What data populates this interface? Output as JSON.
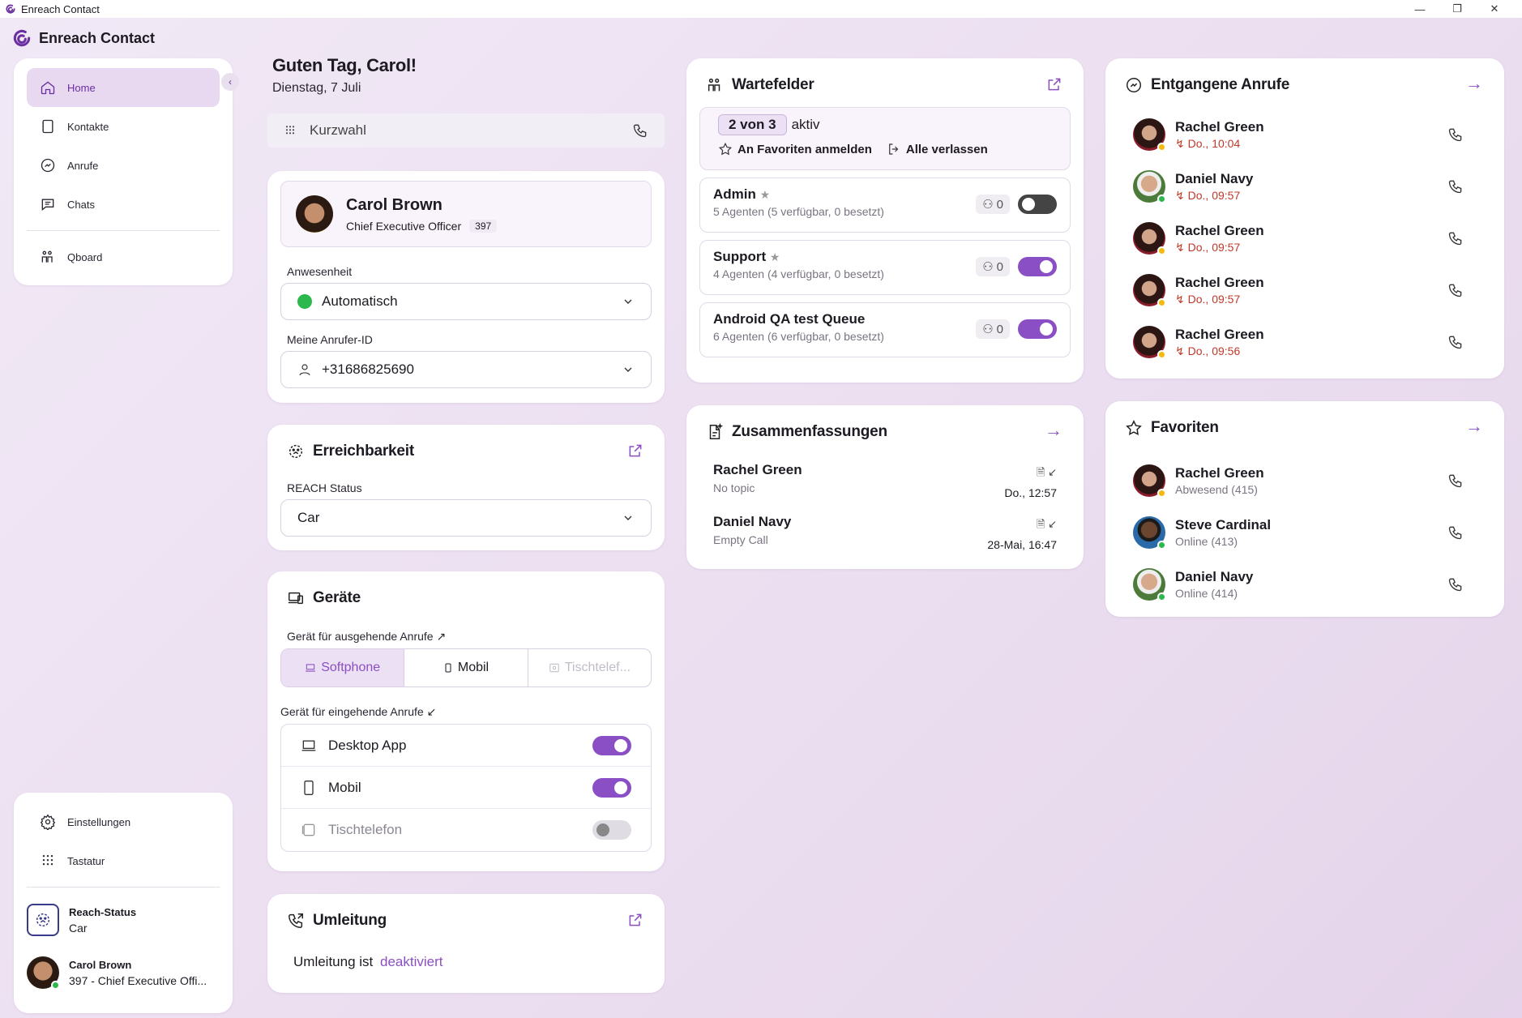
{
  "window": {
    "title": "Enreach Contact"
  },
  "app": {
    "name": "Enreach Contact"
  },
  "colors": {
    "accent": "#8a4fc4",
    "brand": "#6a2fa0",
    "missed": "#c0392b",
    "online": "#2db84d",
    "away": "#f5b90f"
  },
  "sidebar": {
    "items": [
      {
        "label": "Home",
        "icon": "home-icon"
      },
      {
        "label": "Kontakte",
        "icon": "contacts-icon"
      },
      {
        "label": "Anrufe",
        "icon": "calls-icon"
      },
      {
        "label": "Chats",
        "icon": "chat-icon"
      },
      {
        "label": "Qboard",
        "icon": "qboard-icon"
      }
    ],
    "bottom": {
      "settings": "Einstellungen",
      "keypad": "Tastatur",
      "reach_title": "Reach-Status",
      "reach_value": "Car",
      "user_name": "Carol Brown",
      "user_sub": "397  - Chief Executive Offi..."
    }
  },
  "greeting": {
    "title": "Guten Tag, Carol!",
    "date": "Dienstag, 7 Juli"
  },
  "speed_dial": {
    "placeholder": "Kurzwahl"
  },
  "profile": {
    "name": "Carol Brown",
    "role": "Chief Executive Officer",
    "ext": "397",
    "presence_label": "Anwesenheit",
    "presence_value": "Automatisch",
    "callerid_label": "Meine Anrufer-ID",
    "callerid_value": "+31686825690"
  },
  "reachability": {
    "title": "Erreichbarkeit",
    "label": "REACH Status",
    "value": "Car"
  },
  "devices": {
    "title": "Geräte",
    "outgoing_label": "Gerät für ausgehende Anrufe ↗",
    "outgoing_options": [
      "Softphone",
      "Mobil",
      "Tischtelef..."
    ],
    "outgoing_selected": "Softphone",
    "incoming_label": "Gerät für eingehende Anrufe ↙",
    "incoming": [
      {
        "label": "Desktop App",
        "state": "on"
      },
      {
        "label": "Mobil",
        "state": "on"
      },
      {
        "label": "Tischtelefon",
        "state": "disabled"
      }
    ]
  },
  "redirect": {
    "title": "Umleitung",
    "text": "Umleitung ist",
    "state": "deaktiviert"
  },
  "queues": {
    "title": "Wartefelder",
    "active_count": "2 von 3",
    "active_label": "aktiv",
    "fav_signin": "An Favoriten anmelden",
    "leave_all": "Alle verlassen",
    "items": [
      {
        "name": "Admin",
        "sub": "5 Agenten (5 verfügbar, 0 besetzt)",
        "count": "0",
        "on": false,
        "star": true
      },
      {
        "name": "Support",
        "sub": "4 Agenten (4 verfügbar, 0 besetzt)",
        "count": "0",
        "on": true,
        "star": true
      },
      {
        "name": "Android QA test Queue",
        "sub": "6 Agenten (6 verfügbar, 0 besetzt)",
        "count": "0",
        "on": true,
        "star": false
      }
    ]
  },
  "summaries": {
    "title": "Zusammenfassungen",
    "items": [
      {
        "name": "Rachel Green",
        "topic": "No topic",
        "time": "Do., 12:57"
      },
      {
        "name": "Daniel Navy",
        "topic": "Empty Call",
        "time": "28-Mai, 16:47"
      }
    ]
  },
  "missed": {
    "title": "Entgangene Anrufe",
    "items": [
      {
        "name": "Rachel Green",
        "time": "Do., 10:04",
        "avatar": "rachel"
      },
      {
        "name": "Daniel Navy",
        "time": "Do., 09:57",
        "avatar": "daniel"
      },
      {
        "name": "Rachel Green",
        "time": "Do., 09:57",
        "avatar": "rachel"
      },
      {
        "name": "Rachel Green",
        "time": "Do., 09:57",
        "avatar": "rachel"
      },
      {
        "name": "Rachel Green",
        "time": "Do., 09:56",
        "avatar": "rachel"
      }
    ]
  },
  "favorites": {
    "title": "Favoriten",
    "items": [
      {
        "name": "Rachel Green",
        "status": "Abwesend (415)",
        "avatar": "rachel"
      },
      {
        "name": "Steve Cardinal",
        "status": "Online (413)",
        "avatar": "steve"
      },
      {
        "name": "Daniel Navy",
        "status": "Online (414)",
        "avatar": "daniel"
      }
    ]
  }
}
